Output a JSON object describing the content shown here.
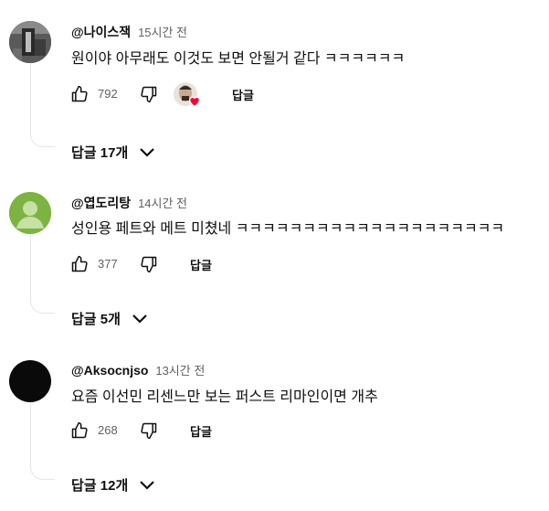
{
  "comments": [
    {
      "author": "@나이스잭",
      "time": "15시간 전",
      "text": "원이야 아무래도 이것도 보면 안될거 같다 ㅋㅋㅋㅋㅋㅋ",
      "likes": "792",
      "reply_label": "답글",
      "replies_label": "답글 17개",
      "avatar": "photo-avatar",
      "creator_heart": true
    },
    {
      "author": "@엽도리탕",
      "time": "14시간 전",
      "text": "성인용 페트와 메트 미쳤네 ㅋㅋㅋㅋㅋㅋㅋㅋㅋㅋㅋㅋㅋㅋㅋㅋㅋㅋㅋㅋ",
      "likes": "377",
      "reply_label": "답글",
      "replies_label": "답글 5개",
      "avatar": "default-green-avatar",
      "creator_heart": false
    },
    {
      "author": "@Aksocnjso",
      "time": "13시간 전",
      "text": "요즘 이선민 리센느만 보는 퍼스트 리마인이면 개추",
      "likes": "268",
      "reply_label": "답글",
      "replies_label": "답글 12개",
      "avatar": "black-avatar",
      "creator_heart": false
    }
  ],
  "colors": {
    "secondary_text": "#606060",
    "thread_line": "#e5e5e5",
    "default_avatar_green": "#7cb342",
    "heart": "#ff0033"
  },
  "icons": [
    "like-icon",
    "dislike-icon",
    "chevron-down-icon",
    "heart-icon"
  ]
}
